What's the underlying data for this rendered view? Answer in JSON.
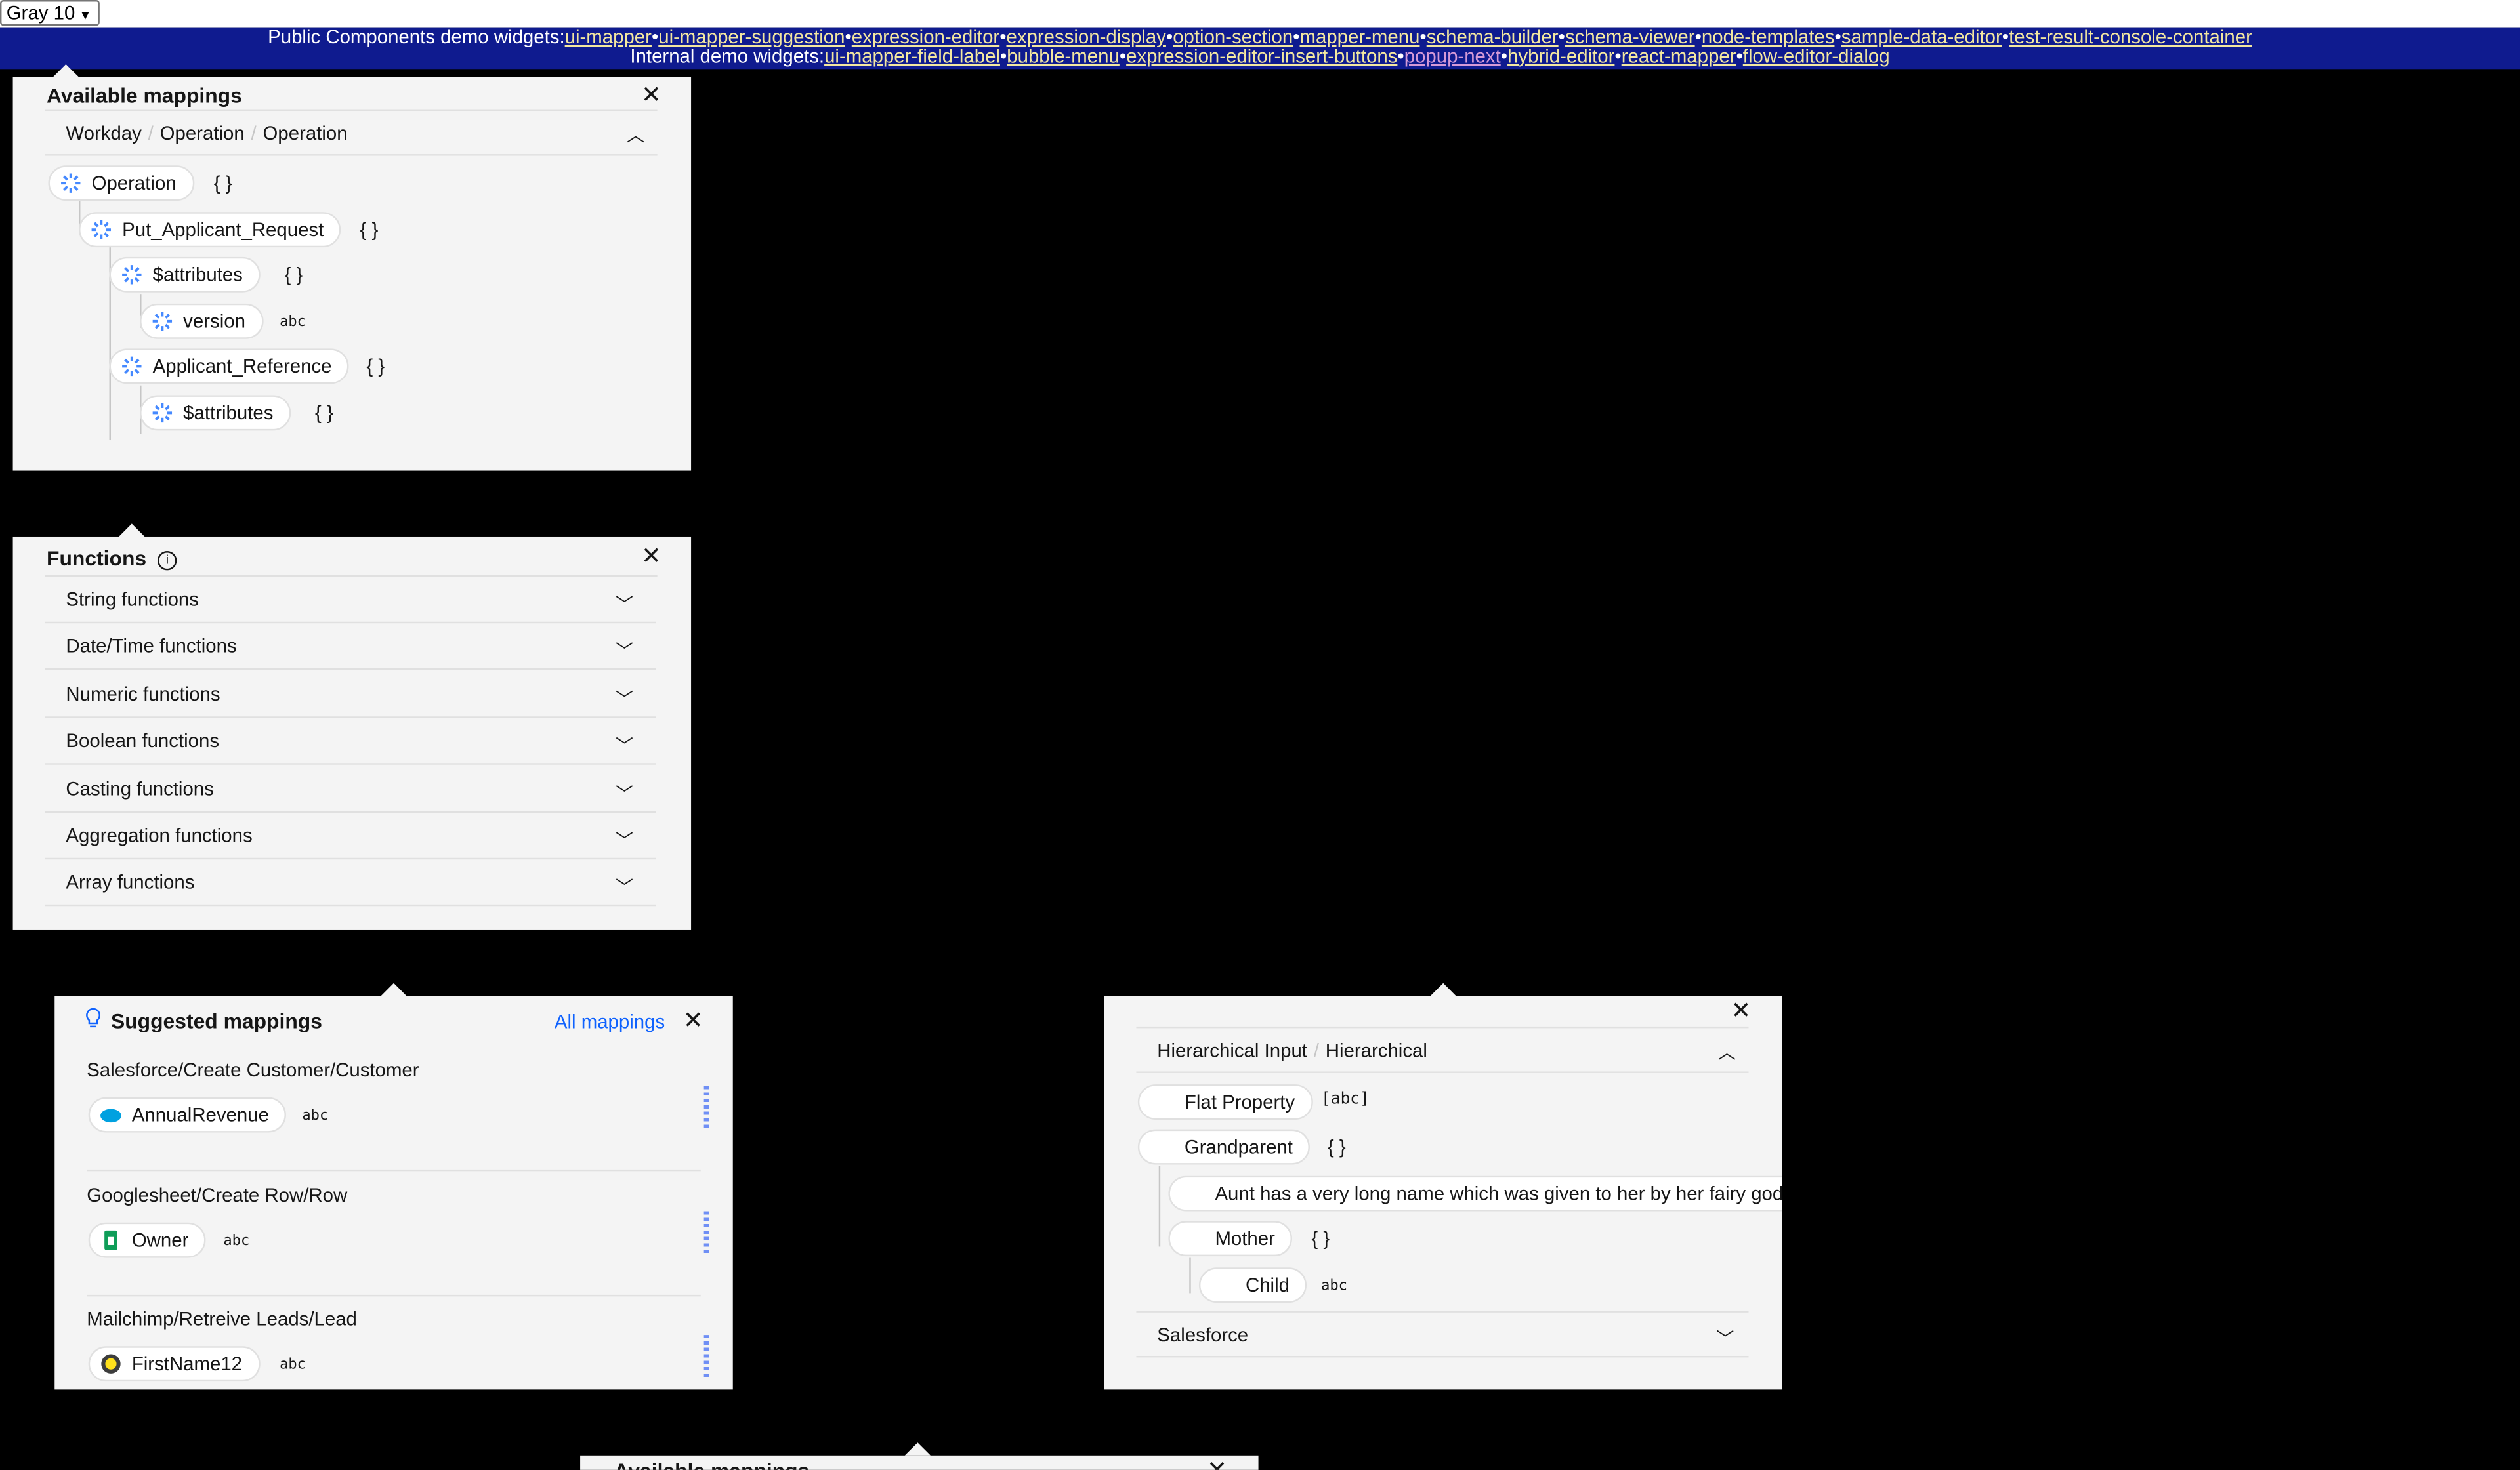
{
  "theme_select": {
    "value": "Gray 10"
  },
  "banner": {
    "public_label": "Public Components demo widgets:",
    "public_links": [
      "ui-mapper",
      "ui-mapper-suggestion",
      "expression-editor",
      "expression-display",
      "option-section",
      "mapper-menu",
      "schema-builder",
      "schema-viewer",
      "node-templates",
      "sample-data-editor",
      "test-result-console-container"
    ],
    "internal_label": "Internal demo widgets:",
    "internal_links": [
      "ui-mapper-field-label",
      "bubble-menu",
      "expression-editor-insert-buttons",
      "popup-next",
      "hybrid-editor",
      "react-mapper",
      "flow-editor-dialog"
    ],
    "separator": "•"
  },
  "available_mappings": {
    "title": "Available mappings",
    "breadcrumb": [
      "Workday",
      "Operation",
      "Operation"
    ],
    "nodes": [
      {
        "label": "Operation",
        "type": "{ }"
      },
      {
        "label": "Put_Applicant_Request",
        "type": "{ }"
      },
      {
        "label": "$attributes",
        "type": "{ }"
      },
      {
        "label": "version",
        "type": "abc"
      },
      {
        "label": "Applicant_Reference",
        "type": "{ }"
      },
      {
        "label": "$attributes",
        "type": "{ }"
      }
    ]
  },
  "functions": {
    "title": "Functions",
    "items": [
      "String functions",
      "Date/Time functions",
      "Numeric functions",
      "Boolean functions",
      "Casting functions",
      "Aggregation functions",
      "Array functions"
    ]
  },
  "suggested": {
    "title": "Suggested mappings",
    "all_link": "All mappings",
    "groups": [
      {
        "source": "Salesforce/Create Customer/Customer",
        "field": "AnnualRevenue",
        "type": "abc"
      },
      {
        "source": "Googlesheet/Create Row/Row",
        "field": "Owner",
        "type": "abc"
      },
      {
        "source": "Mailchimp/Retreive Leads/Lead",
        "field": "FirstName12",
        "type": "abc"
      }
    ]
  },
  "hierarchical": {
    "breadcrumb": [
      "Hierarchical Input",
      "Hierarchical"
    ],
    "nodes": [
      {
        "label": "Flat Property",
        "type": "[abc]"
      },
      {
        "label": "Grandparent",
        "type": "{ }"
      },
      {
        "label": "Aunt has a very long name which was given to her by her fairy godmother"
      },
      {
        "label": "Mother",
        "type": "{ }"
      },
      {
        "label": "Child",
        "type": "abc"
      }
    ],
    "section": "Salesforce"
  },
  "bottom_panel": {
    "title": "Available mappings"
  },
  "colors": {
    "banner_bg": "#0f1b8f",
    "link": "#f3e7a0",
    "visited_link": "#d59ad7",
    "accent": "#0f62fe",
    "panel_bg": "#f4f4f4"
  }
}
